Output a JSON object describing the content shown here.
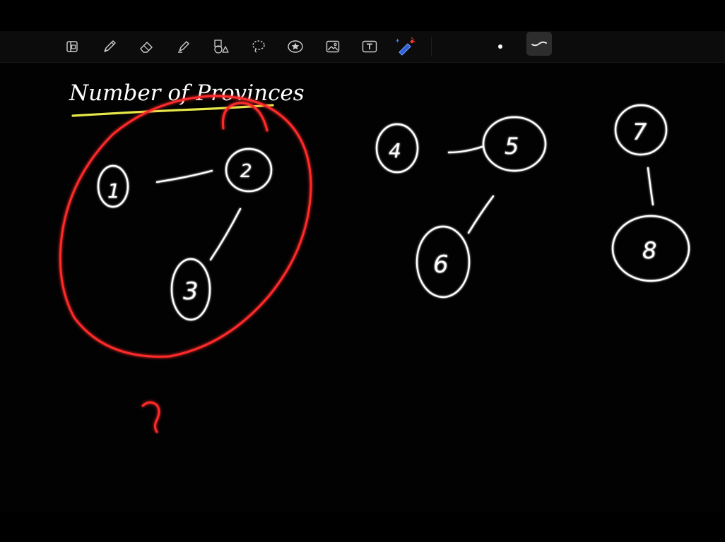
{
  "app": {
    "toolbar": {
      "tools": [
        {
          "name": "pages-icon",
          "label": "Pages"
        },
        {
          "name": "pen-icon",
          "label": "Pen"
        },
        {
          "name": "eraser-icon",
          "label": "Eraser"
        },
        {
          "name": "highlighter-icon",
          "label": "Highlighter"
        },
        {
          "name": "shapes-icon",
          "label": "Shapes"
        },
        {
          "name": "lasso-icon",
          "label": "Lasso"
        },
        {
          "name": "sticker-icon",
          "label": "Sticker"
        },
        {
          "name": "image-icon",
          "label": "Image"
        },
        {
          "name": "text-tool-icon",
          "label": "Text"
        },
        {
          "name": "laser-pointer-icon",
          "label": "Laser Pointer"
        }
      ],
      "active_color": "#ffffff",
      "selected_stroke": "thin-curve"
    }
  },
  "canvas": {
    "title": "Number of Provinces",
    "title_underline_color": "#e8e84a",
    "highlight_color": "#ff2a2a",
    "answer_mark": "2",
    "nodes": [
      {
        "id": "node-1",
        "label": "1"
      },
      {
        "id": "node-2",
        "label": "2"
      },
      {
        "id": "node-3",
        "label": "3"
      },
      {
        "id": "node-4",
        "label": "4"
      },
      {
        "id": "node-5",
        "label": "5"
      },
      {
        "id": "node-6",
        "label": "6"
      },
      {
        "id": "node-7",
        "label": "7"
      },
      {
        "id": "node-8",
        "label": "8"
      }
    ],
    "edges": [
      [
        "1",
        "2"
      ],
      [
        "2",
        "3"
      ],
      [
        "4",
        "5"
      ],
      [
        "5",
        "6"
      ],
      [
        "7",
        "8"
      ]
    ]
  }
}
